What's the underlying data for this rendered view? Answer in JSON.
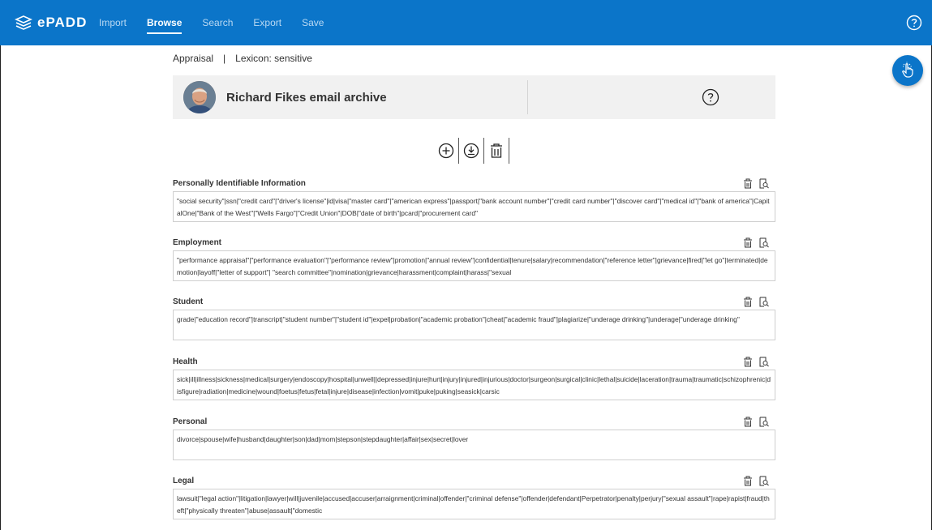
{
  "app": {
    "brand": "ePADD",
    "nav": [
      "Import",
      "Browse",
      "Search",
      "Export",
      "Save"
    ],
    "active_nav": "Browse"
  },
  "breadcrumb": {
    "section": "Appraisal",
    "separator": "|",
    "lexicon": "Lexicon: sensitive"
  },
  "archive": {
    "title": "Richard Fikes email archive"
  },
  "toolbar": {
    "icons": [
      "add-icon",
      "download-icon",
      "delete-icon"
    ]
  },
  "lexicon": [
    {
      "name": "Personally Identifiable Information",
      "terms": "\"social security\"|ssn|\"credit card\"|\"driver's license\"|id|visa|\"master card\"|\"american express\"|passport|\"bank account number\"|\"credit card number\"|\"discover card\"|\"medical id\"|\"bank of america\"|CapitalOne|\"Bank of the West\"|\"Wells Fargo\"|\"Credit Union\"|DOB|\"date of birth\"|pcard|\"procurement card\""
    },
    {
      "name": "Employment",
      "terms": "\"performance appraisal\"|\"performance evaluation\"|\"performance review\"|promotion|\"annual review\"|confidential|tenure|salary|recommendation|\"reference letter\"|grievance|fired|\"let go\"|terminated|demotion|layoff|\"letter of support\"| \"search committee\"|nomination|grievance|harassment|complaint|harass|\"sexual"
    },
    {
      "name": "Student",
      "terms": "grade|\"education record\"|transcript|\"student number\"|\"student id\"|expel|probation|\"academic probation\"|cheat|\"academic fraud\"|plagiarize|\"underage drinking\"|underage|\"underage drinking\""
    },
    {
      "name": "Health",
      "terms": "sick|ill|illness|sickness|medical|surgery|endoscopy|hospital|unwell||depressed|injure|hurt|injury|injured|injurious|doctor|surgeon|surgical|clinic|lethal|suicide|laceration|trauma|traumatic|schizophrenic|disfigure|radiation|medicine|wound|foetus|fetus|fetal|injure|disease|infection|vomit|puke|puking|seasick|carsic"
    },
    {
      "name": "Personal",
      "terms": "divorce|spouse|wife|husband|daughter|son|dad|mom|stepson|stepdaughter|affair|sex|secret|lover"
    },
    {
      "name": "Legal",
      "terms": "lawsuit|\"legal action\"|litigation|lawyer|will|juvenile|accused|accuser|arraignment|criminal|offender|\"criminal defense\"|offender|defendant|Perpetrator|penalty|perjury|\"sexual assault\"|rape|rapist|fraud|theft|\"physically threaten\"|abuse|assault|\"domestic"
    }
  ],
  "colors": {
    "navbar": "#0b75c9",
    "header_card": "#f1f1f1"
  }
}
